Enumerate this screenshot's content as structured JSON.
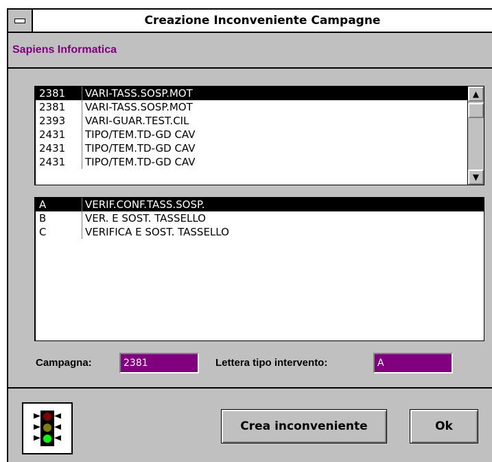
{
  "window": {
    "title": "Creazione Inconveniente Campagne"
  },
  "company": "Sapiens Informatica",
  "campaign_list": {
    "rows": [
      {
        "code": "2381",
        "desc": "VARI-TASS.SOSP.MOT",
        "selected": true
      },
      {
        "code": "2381",
        "desc": "VARI-TASS.SOSP.MOT",
        "selected": false
      },
      {
        "code": "2393",
        "desc": "VARI-GUAR.TEST.CIL",
        "selected": false
      },
      {
        "code": "2431",
        "desc": "TIPO/TEM.TD-GD CAV",
        "selected": false
      },
      {
        "code": "2431",
        "desc": "TIPO/TEM.TD-GD CAV",
        "selected": false
      },
      {
        "code": "2431",
        "desc": "TIPO/TEM.TD-GD CAV",
        "selected": false
      }
    ]
  },
  "intervention_list": {
    "rows": [
      {
        "code": "A",
        "desc": "VERIF.CONF.TASS.SOSP.",
        "selected": true
      },
      {
        "code": "B",
        "desc": "VER. E SOST. TASSELLO",
        "selected": false
      },
      {
        "code": "C",
        "desc": "VERIFICA E SOST. TASSELLO",
        "selected": false
      }
    ]
  },
  "form": {
    "campagna_label": "Campagna:",
    "campagna_value": "2381",
    "lettera_label": "Lettera tipo intervento:",
    "lettera_value": "A"
  },
  "buttons": {
    "crea_label": "Crea inconveniente",
    "ok_label": "Ok",
    "traffic_icon": "traffic-light-icon"
  },
  "colors": {
    "accent": "#800080",
    "window_bg": "#c0c0c0",
    "selection_bg": "#000000"
  }
}
